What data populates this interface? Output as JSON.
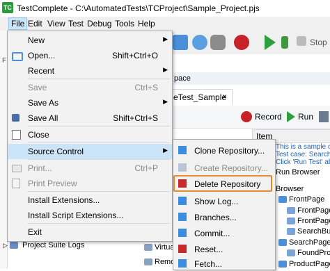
{
  "window": {
    "title": "TestComplete - C:\\AutomatedTests\\TCProject\\Sample_Project.pjs"
  },
  "menubar": {
    "items": [
      "File",
      "Edit",
      "View",
      "Test",
      "Debug",
      "Tools",
      "Help"
    ],
    "active": "File"
  },
  "toolbar": {
    "stop_label": "Stop"
  },
  "left_strip_letter": "F",
  "panel_title": "pace",
  "doc_tab": {
    "label": "eTest_Sample",
    "close": "×"
  },
  "keyword_toolbar": {
    "record_label": "Record",
    "run_label": "Run"
  },
  "grid": {
    "item_header": "Item"
  },
  "description_lines": [
    "This is a sample of v",
    "Test case: Search th",
    "Click 'Run Test' abov"
  ],
  "tree": {
    "items": [
      "Run Browser",
      "Browser",
      "FrontPage",
      "FrontPageS",
      "FrontPageS",
      "SearchButt",
      "SearchPage",
      "FoundProd",
      "ProductPage"
    ]
  },
  "file_menu": {
    "items": [
      {
        "label": "New",
        "shortcut": "",
        "arrow": true,
        "disabled": false,
        "icon": ""
      },
      {
        "label": "Open...",
        "shortcut": "Shift+Ctrl+O",
        "arrow": false,
        "disabled": false,
        "icon": "open-folder-icon"
      },
      {
        "label": "Recent",
        "shortcut": "",
        "arrow": true,
        "disabled": false,
        "icon": ""
      },
      {
        "label": "Save",
        "shortcut": "Ctrl+S",
        "arrow": false,
        "disabled": true,
        "icon": "save-icon"
      },
      {
        "label": "Save As",
        "shortcut": "",
        "arrow": true,
        "disabled": false,
        "icon": ""
      },
      {
        "label": "Save All",
        "shortcut": "Shift+Ctrl+S",
        "arrow": false,
        "disabled": false,
        "icon": "save-all-icon"
      },
      {
        "label": "Close",
        "shortcut": "",
        "arrow": false,
        "disabled": false,
        "icon": "close-document-icon"
      },
      {
        "label": "Source Control",
        "shortcut": "",
        "arrow": true,
        "disabled": false,
        "icon": ""
      },
      {
        "label": "Print...",
        "shortcut": "Ctrl+P",
        "arrow": false,
        "disabled": true,
        "icon": "print-icon"
      },
      {
        "label": "Print Preview",
        "shortcut": "",
        "arrow": false,
        "disabled": true,
        "icon": "print-preview-icon"
      },
      {
        "label": "Install Extensions...",
        "shortcut": "",
        "arrow": false,
        "disabled": false,
        "icon": ""
      },
      {
        "label": "Install Script Extensions...",
        "shortcut": "",
        "arrow": false,
        "disabled": false,
        "icon": ""
      },
      {
        "label": "Exit",
        "shortcut": "",
        "arrow": false,
        "disabled": false,
        "icon": ""
      }
    ]
  },
  "source_control_menu": {
    "items": [
      {
        "label": "Clone Repository...",
        "disabled": false
      },
      {
        "label": "Create Repository...",
        "disabled": true
      },
      {
        "label": "Delete Repository",
        "disabled": false
      },
      {
        "label": "Show Log...",
        "disabled": false
      },
      {
        "label": "Branches...",
        "disabled": false
      },
      {
        "label": "Commit...",
        "disabled": false
      },
      {
        "label": "Reset...",
        "disabled": false
      },
      {
        "label": "Fetch...",
        "disabled": false
      }
    ]
  },
  "bottom": {
    "project_suite_logs": "Project Suite Logs",
    "virtual": "Virtua",
    "remote": "Remo"
  },
  "colors": {
    "highlight": "#cce4f7",
    "frame": "#e8892a",
    "link_blue": "#1a5fb4"
  }
}
